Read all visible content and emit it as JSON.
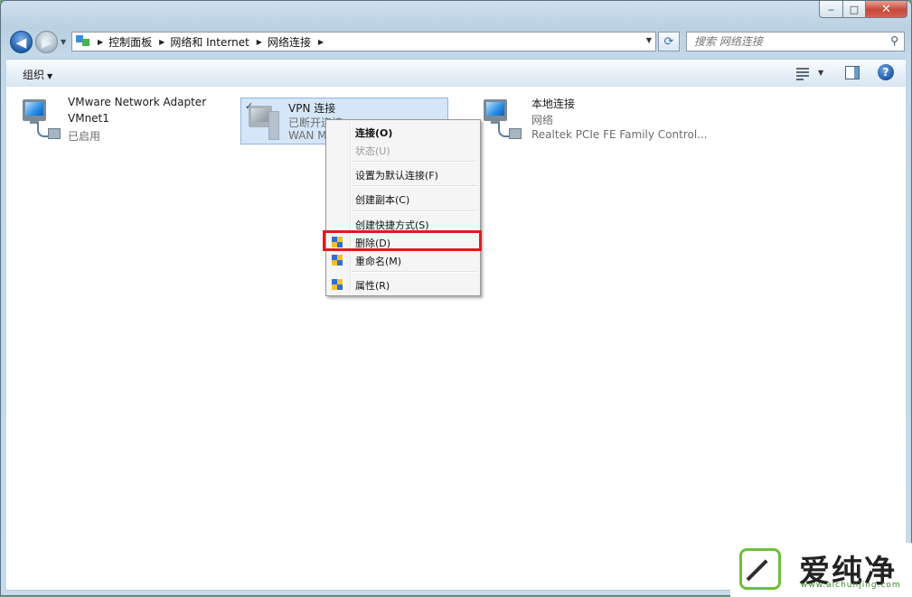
{
  "window": {
    "caption": {
      "minimize": "‒",
      "maximize": "□",
      "close": "✕"
    }
  },
  "nav": {
    "back": "◀",
    "forward": "▶",
    "breadcrumbs": [
      "控制面板",
      "网络和 Internet",
      "网络连接"
    ],
    "search_placeholder": "搜索 网络连接"
  },
  "toolbar": {
    "organize": "组织",
    "help": "?"
  },
  "connections": [
    {
      "name": "VMware Network Adapter",
      "line2": "VMnet1",
      "line3": "已启用"
    },
    {
      "name": "VPN 连接",
      "line2": "已断开连接",
      "line3": "WAN M..."
    },
    {
      "name": "本地连接",
      "line2": "网络",
      "line3": "Realtek PCIe FE Family Control..."
    }
  ],
  "context_menu": {
    "items": [
      {
        "label": "连接(O)",
        "bold": true
      },
      {
        "label": "状态(U)",
        "disabled": true
      },
      {
        "label": "设置为默认连接(F)"
      },
      {
        "label": "创建副本(C)"
      },
      {
        "label": "创建快捷方式(S)"
      },
      {
        "label": "删除(D)",
        "shield": true,
        "highlighted": true
      },
      {
        "label": "重命名(M)",
        "shield": true
      },
      {
        "label": "属性(R)",
        "shield": true
      }
    ]
  },
  "watermark": {
    "text": "爱纯净",
    "url": "www.aichunjing.com"
  },
  "colors": {
    "highlight_box": "#e11b1b",
    "selection": "#d5e6f8"
  }
}
